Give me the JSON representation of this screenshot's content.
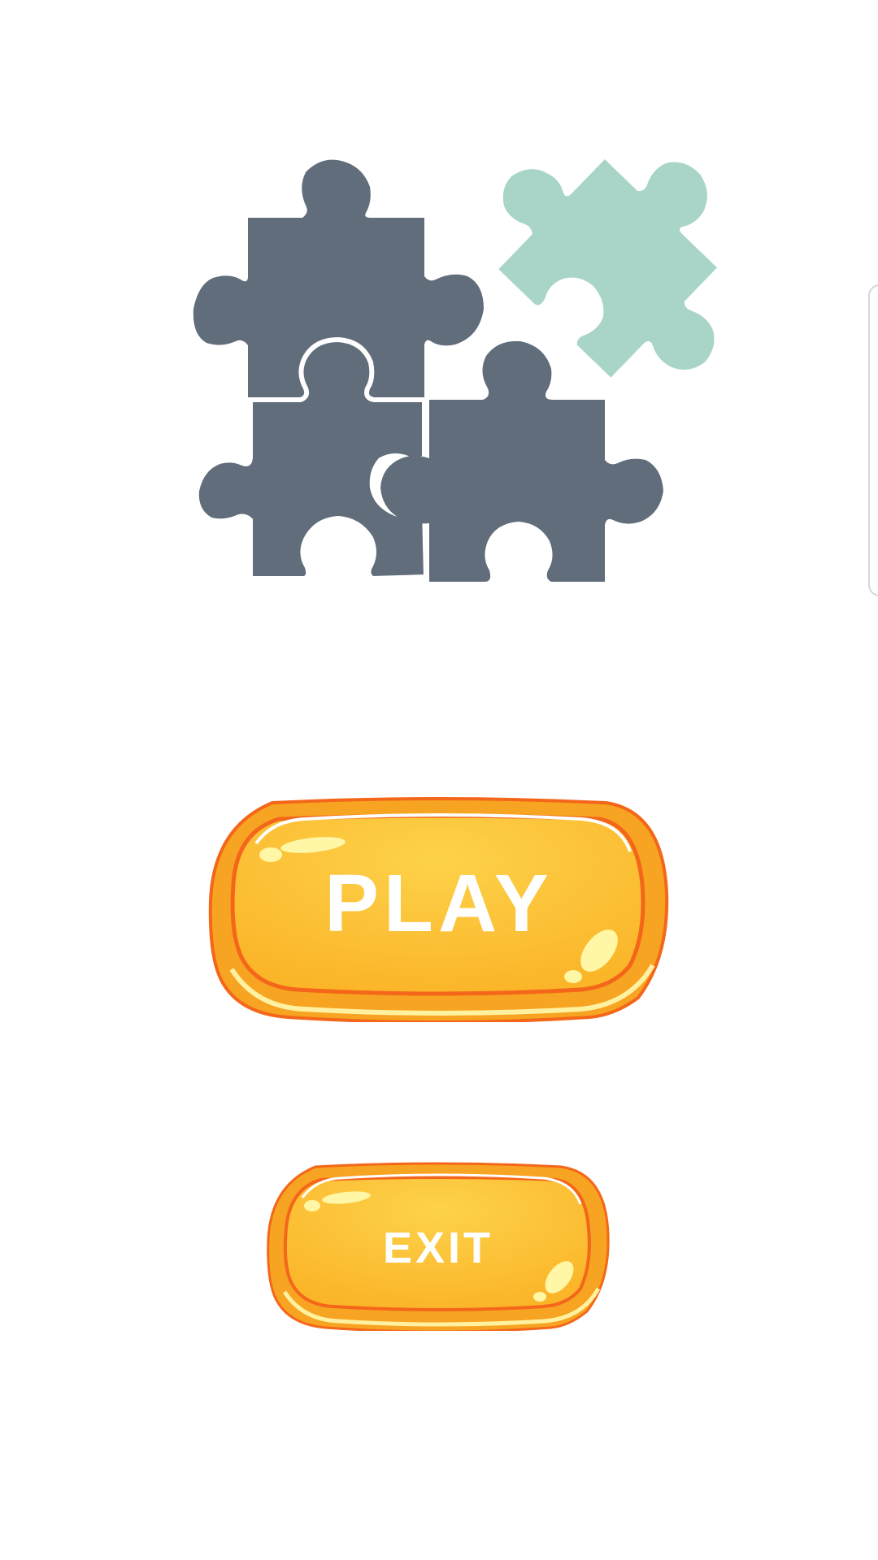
{
  "logo": {
    "name": "puzzle-pieces-logo",
    "colors": {
      "dark_piece": "#616d7b",
      "accent_piece": "#a9d5c8",
      "outline": "#ffffff"
    }
  },
  "menu": {
    "play_label": "PLAY",
    "exit_label": "EXIT"
  },
  "theme": {
    "button_fill_light": "#fdd24a",
    "button_fill_dark": "#fbb529",
    "button_edge": "#f4671a",
    "highlight": "#fff6a6",
    "background": "#ffffff"
  }
}
